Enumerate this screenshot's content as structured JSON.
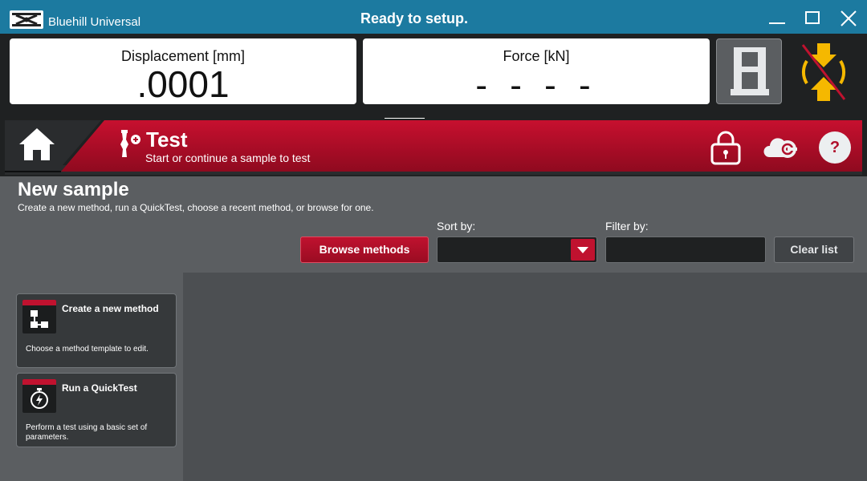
{
  "app": {
    "name": "Bluehill Universal",
    "status": "Ready to setup."
  },
  "window": {
    "minimize_icon": "minimize-icon",
    "maximize_icon": "maximize-icon",
    "close_icon": "close-icon"
  },
  "readouts": {
    "displacement": {
      "label": "Displacement [mm]",
      "value": ".0001"
    },
    "force": {
      "label": "Force [kN]",
      "value": "- - - -"
    }
  },
  "header": {
    "title": "Test",
    "subtitle": "Start or continue a sample to test",
    "icons": [
      "home-icon",
      "test-icon",
      "lock-icon",
      "cloud-icon",
      "help-icon"
    ],
    "help_label": "?"
  },
  "main": {
    "title": "New sample",
    "description": "Create a new method, run a QuickTest, choose a recent method, or browse for one.",
    "browse_button": "Browse methods",
    "sort": {
      "label": "Sort by:",
      "value": ""
    },
    "filter": {
      "label": "Filter by:",
      "value": ""
    },
    "clear_button": "Clear list",
    "cards": [
      {
        "title": "Create a new method",
        "description": "Choose a method template to edit.",
        "icon": "method-template-icon"
      },
      {
        "title": "Run a QuickTest",
        "description": "Perform a test using a basic set of parameters.",
        "icon": "stopwatch-icon"
      }
    ]
  },
  "colors": {
    "titlebar": "#1c7aa0",
    "accent_red": "#c0122f",
    "dark": "#1f2122",
    "background": "#5b5e61",
    "jog_yellow": "#f5b800"
  }
}
